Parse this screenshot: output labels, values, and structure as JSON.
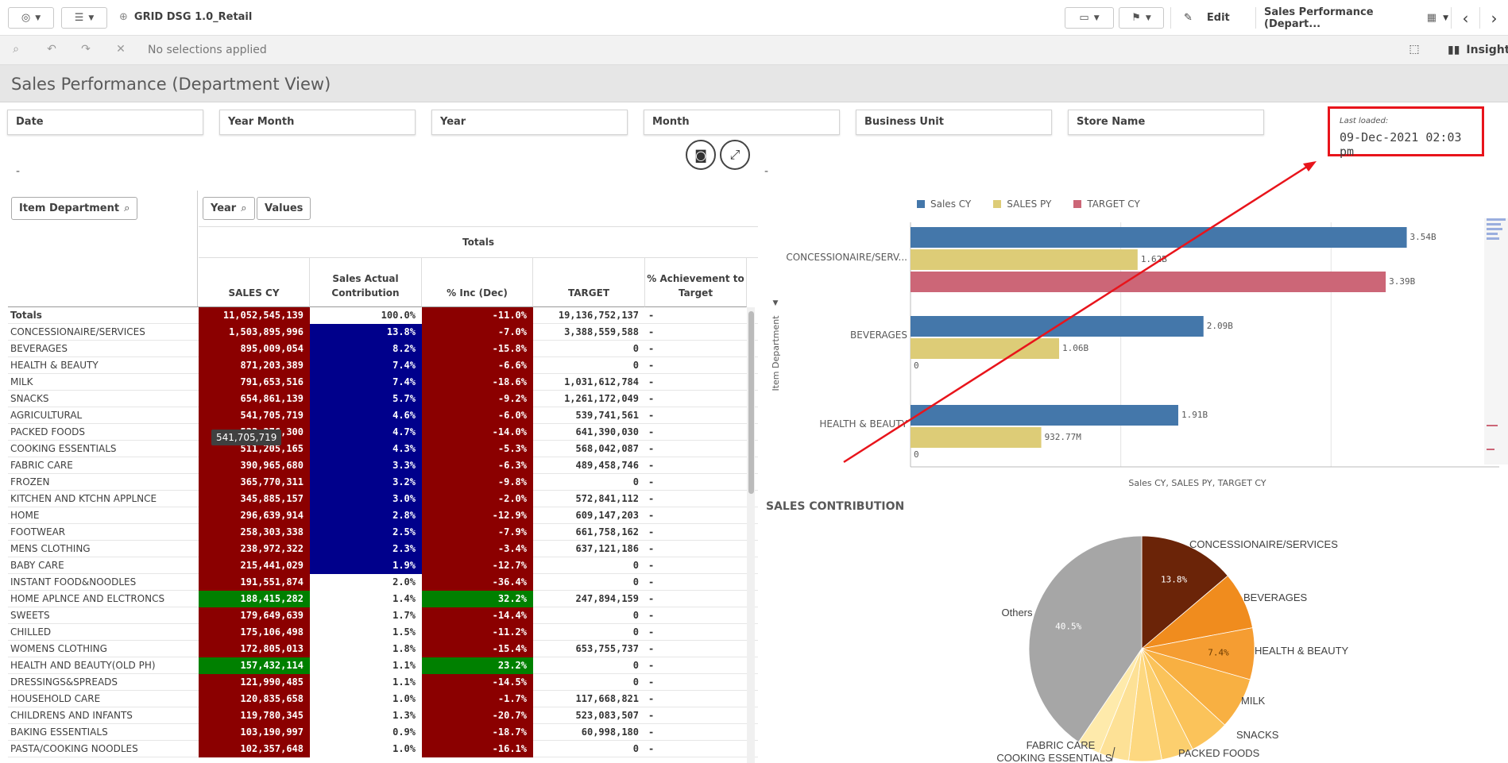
{
  "app": {
    "title": "GRID DSG 1.0_Retail",
    "edit_label": "Edit",
    "sheet_dropdown": "Sales Performance (Depart..."
  },
  "selections": {
    "text": "No selections applied",
    "insights_label": "Insight"
  },
  "sheet": {
    "title": "Sales Performance (Department View)"
  },
  "filters": [
    "Date",
    "Year Month",
    "Year",
    "Month",
    "Business Unit",
    "Store Name"
  ],
  "last_loaded": {
    "label": "Last loaded:",
    "value": "09-Dec-2021 02:03 pm"
  },
  "dashes": [
    "-",
    "-"
  ],
  "pivot": {
    "dim_button": "Item Department",
    "year_button": "Year",
    "values_button": "Values",
    "totals_label": "Totals",
    "columns": [
      "SALES CY",
      "Sales Actual Contribution",
      "% Inc (Dec)",
      "TARGET",
      "% Achievement to Target"
    ],
    "rows": [
      {
        "name": "Totals",
        "sales": "11,052,545,139",
        "contrib": "100.0%",
        "inc": "-11.0%",
        "target": "19,136,752,137",
        "ach": "-",
        "sc": "#8b0000",
        "cc": "#ffffff",
        "ic": "#8b0000"
      },
      {
        "name": "CONCESSIONAIRE/SERVICES",
        "sales": "1,503,895,996",
        "contrib": "13.8%",
        "inc": "-7.0%",
        "target": "3,388,559,588",
        "ach": "-",
        "sc": "#8b0000",
        "cc": "#00008b",
        "ic": "#8b0000"
      },
      {
        "name": "BEVERAGES",
        "sales": "895,009,054",
        "contrib": "8.2%",
        "inc": "-15.8%",
        "target": "0",
        "ach": "-",
        "sc": "#8b0000",
        "cc": "#00008b",
        "ic": "#8b0000"
      },
      {
        "name": "HEALTH & BEAUTY",
        "sales": "871,203,389",
        "contrib": "7.4%",
        "inc": "-6.6%",
        "target": "0",
        "ach": "-",
        "sc": "#8b0000",
        "cc": "#00008b",
        "ic": "#8b0000"
      },
      {
        "name": "MILK",
        "sales": "791,653,516",
        "contrib": "7.4%",
        "inc": "-18.6%",
        "target": "1,031,612,784",
        "ach": "-",
        "sc": "#8b0000",
        "cc": "#00008b",
        "ic": "#8b0000"
      },
      {
        "name": "SNACKS",
        "sales": "654,861,139",
        "contrib": "5.7%",
        "inc": "-9.2%",
        "target": "1,261,172,049",
        "ach": "-",
        "sc": "#8b0000",
        "cc": "#00008b",
        "ic": "#8b0000"
      },
      {
        "name": "AGRICULTURAL",
        "sales": "541,705,719",
        "contrib": "4.6%",
        "inc": "-6.0%",
        "target": "539,741,561",
        "ach": "-",
        "sc": "#8b0000",
        "cc": "#00008b",
        "ic": "#8b0000"
      },
      {
        "name": "PACKED FOODS",
        "sales": "533,376,300",
        "contrib": "4.7%",
        "inc": "-14.0%",
        "target": "641,390,030",
        "ach": "-",
        "sc": "#8b0000",
        "cc": "#00008b",
        "ic": "#8b0000"
      },
      {
        "name": "COOKING ESSENTIALS",
        "sales": "511,205,165",
        "contrib": "4.3%",
        "inc": "-5.3%",
        "target": "568,042,087",
        "ach": "-",
        "sc": "#8b0000",
        "cc": "#00008b",
        "ic": "#8b0000"
      },
      {
        "name": "FABRIC CARE",
        "sales": "390,965,680",
        "contrib": "3.3%",
        "inc": "-6.3%",
        "target": "489,458,746",
        "ach": "-",
        "sc": "#8b0000",
        "cc": "#00008b",
        "ic": "#8b0000"
      },
      {
        "name": "FROZEN",
        "sales": "365,770,311",
        "contrib": "3.2%",
        "inc": "-9.8%",
        "target": "0",
        "ach": "-",
        "sc": "#8b0000",
        "cc": "#00008b",
        "ic": "#8b0000"
      },
      {
        "name": "KITCHEN AND KTCHN APPLNCE",
        "sales": "345,885,157",
        "contrib": "3.0%",
        "inc": "-2.0%",
        "target": "572,841,112",
        "ach": "-",
        "sc": "#8b0000",
        "cc": "#00008b",
        "ic": "#8b0000"
      },
      {
        "name": "HOME",
        "sales": "296,639,914",
        "contrib": "2.8%",
        "inc": "-12.9%",
        "target": "609,147,203",
        "ach": "-",
        "sc": "#8b0000",
        "cc": "#00008b",
        "ic": "#8b0000"
      },
      {
        "name": "FOOTWEAR",
        "sales": "258,303,338",
        "contrib": "2.5%",
        "inc": "-7.9%",
        "target": "661,758,162",
        "ach": "-",
        "sc": "#8b0000",
        "cc": "#00008b",
        "ic": "#8b0000"
      },
      {
        "name": "MENS CLOTHING",
        "sales": "238,972,322",
        "contrib": "2.3%",
        "inc": "-3.4%",
        "target": "637,121,186",
        "ach": "-",
        "sc": "#8b0000",
        "cc": "#00008b",
        "ic": "#8b0000"
      },
      {
        "name": "BABY CARE",
        "sales": "215,441,029",
        "contrib": "1.9%",
        "inc": "-12.7%",
        "target": "0",
        "ach": "-",
        "sc": "#8b0000",
        "cc": "#00008b",
        "ic": "#8b0000"
      },
      {
        "name": "INSTANT FOOD&NOODLES",
        "sales": "191,551,874",
        "contrib": "2.0%",
        "inc": "-36.4%",
        "target": "0",
        "ach": "-",
        "sc": "#8b0000",
        "cc": "#ffffff",
        "ic": "#8b0000"
      },
      {
        "name": "HOME APLNCE AND ELCTRONCS",
        "sales": "188,415,282",
        "contrib": "1.4%",
        "inc": "32.2%",
        "target": "247,894,159",
        "ach": "-",
        "sc": "#008000",
        "cc": "#ffffff",
        "ic": "#008000"
      },
      {
        "name": "SWEETS",
        "sales": "179,649,639",
        "contrib": "1.7%",
        "inc": "-14.4%",
        "target": "0",
        "ach": "-",
        "sc": "#8b0000",
        "cc": "#ffffff",
        "ic": "#8b0000"
      },
      {
        "name": "CHILLED",
        "sales": "175,106,498",
        "contrib": "1.5%",
        "inc": "-11.2%",
        "target": "0",
        "ach": "-",
        "sc": "#8b0000",
        "cc": "#ffffff",
        "ic": "#8b0000"
      },
      {
        "name": "WOMENS CLOTHING",
        "sales": "172,805,013",
        "contrib": "1.8%",
        "inc": "-15.4%",
        "target": "653,755,737",
        "ach": "-",
        "sc": "#8b0000",
        "cc": "#ffffff",
        "ic": "#8b0000"
      },
      {
        "name": "HEALTH AND BEAUTY(OLD PH)",
        "sales": "157,432,114",
        "contrib": "1.1%",
        "inc": "23.2%",
        "target": "0",
        "ach": "-",
        "sc": "#008000",
        "cc": "#ffffff",
        "ic": "#008000"
      },
      {
        "name": "DRESSINGS&SPREADS",
        "sales": "121,990,485",
        "contrib": "1.1%",
        "inc": "-14.5%",
        "target": "0",
        "ach": "-",
        "sc": "#8b0000",
        "cc": "#ffffff",
        "ic": "#8b0000"
      },
      {
        "name": "HOUSEHOLD CARE",
        "sales": "120,835,658",
        "contrib": "1.0%",
        "inc": "-1.7%",
        "target": "117,668,821",
        "ach": "-",
        "sc": "#8b0000",
        "cc": "#ffffff",
        "ic": "#8b0000"
      },
      {
        "name": "CHILDRENS AND INFANTS",
        "sales": "119,780,345",
        "contrib": "1.3%",
        "inc": "-20.7%",
        "target": "523,083,507",
        "ach": "-",
        "sc": "#8b0000",
        "cc": "#ffffff",
        "ic": "#8b0000"
      },
      {
        "name": "BAKING ESSENTIALS",
        "sales": "103,190,997",
        "contrib": "0.9%",
        "inc": "-18.7%",
        "target": "60,998,180",
        "ach": "-",
        "sc": "#8b0000",
        "cc": "#ffffff",
        "ic": "#8b0000"
      },
      {
        "name": "PASTA/COOKING NOODLES",
        "sales": "102,357,648",
        "contrib": "1.0%",
        "inc": "-16.1%",
        "target": "0",
        "ach": "-",
        "sc": "#8b0000",
        "cc": "#ffffff",
        "ic": "#8b0000"
      }
    ],
    "tooltip": "541,705,719"
  },
  "bar_chart": {
    "legend": [
      {
        "name": "Sales CY",
        "color": "#4477aa"
      },
      {
        "name": "SALES PY",
        "color": "#ddcc77"
      },
      {
        "name": "TARGET CY",
        "color": "#cc6677"
      }
    ],
    "y_axis_title": "Item Department",
    "x_axis_title": "Sales CY, SALES PY, TARGET CY"
  },
  "pie_chart": {
    "title": "SALES CONTRIBUTION"
  },
  "chart_data": [
    {
      "type": "bar",
      "orientation": "horizontal",
      "categories": [
        "CONCESSIONAIRE/SERV...",
        "BEVERAGES",
        "HEALTH & BEAUTY"
      ],
      "series": [
        {
          "name": "Sales CY",
          "values": [
            3.54,
            2.09,
            1.91
          ],
          "labels": [
            "3.54B",
            "2.09B",
            "1.91B"
          ],
          "color": "#4477aa"
        },
        {
          "name": "SALES PY",
          "values": [
            1.62,
            1.06,
            0.93277
          ],
          "labels": [
            "1.62B",
            "1.06B",
            "932.77M"
          ],
          "color": "#ddcc77"
        },
        {
          "name": "TARGET CY",
          "values": [
            3.39,
            0,
            0
          ],
          "labels": [
            "3.39B",
            "0",
            "0"
          ],
          "color": "#cc6677"
        }
      ],
      "xlim": [
        0,
        4.2
      ],
      "ylabel": "Item Department",
      "xlabel": "Sales CY, SALES PY, TARGET CY"
    },
    {
      "type": "pie",
      "title": "SALES CONTRIBUTION",
      "slices": [
        {
          "name": "CONCESSIONAIRE/SERVICES",
          "value": 13.8,
          "label": "13.8%",
          "color": "#6b2408"
        },
        {
          "name": "BEVERAGES",
          "value": 8.2,
          "label": "",
          "color": "#f08c1e"
        },
        {
          "name": "HEALTH & BEAUTY",
          "value": 7.4,
          "label": "7.4%",
          "color": "#f59d32"
        },
        {
          "name": "MILK",
          "value": 7.4,
          "label": "",
          "color": "#f8b042"
        },
        {
          "name": "SNACKS",
          "value": 5.7,
          "label": "",
          "color": "#fbc35a"
        },
        {
          "name": "AGRICULTURAL",
          "value": 4.6,
          "label": "",
          "color": "#fccf6e"
        },
        {
          "name": "PACKED FOODS",
          "value": 4.7,
          "label": "",
          "color": "#fdd880"
        },
        {
          "name": "COOKING ESSENTIALS",
          "value": 4.3,
          "label": "",
          "color": "#fde196"
        },
        {
          "name": "FABRIC CARE",
          "value": 3.3,
          "label": "",
          "color": "#feeaab"
        },
        {
          "name": "Others",
          "value": 40.5,
          "label": "40.5%",
          "color": "#a6a6a6"
        }
      ],
      "outer_labels": [
        "CONCESSIONAIRE/SERVICES",
        "BEVERAGES",
        "HEALTH & BEAUTY",
        "MILK",
        "SNACKS",
        "PACKED FOODS",
        "FABRIC CARE",
        "COOKING ESSENTIALS",
        "Others"
      ]
    }
  ]
}
